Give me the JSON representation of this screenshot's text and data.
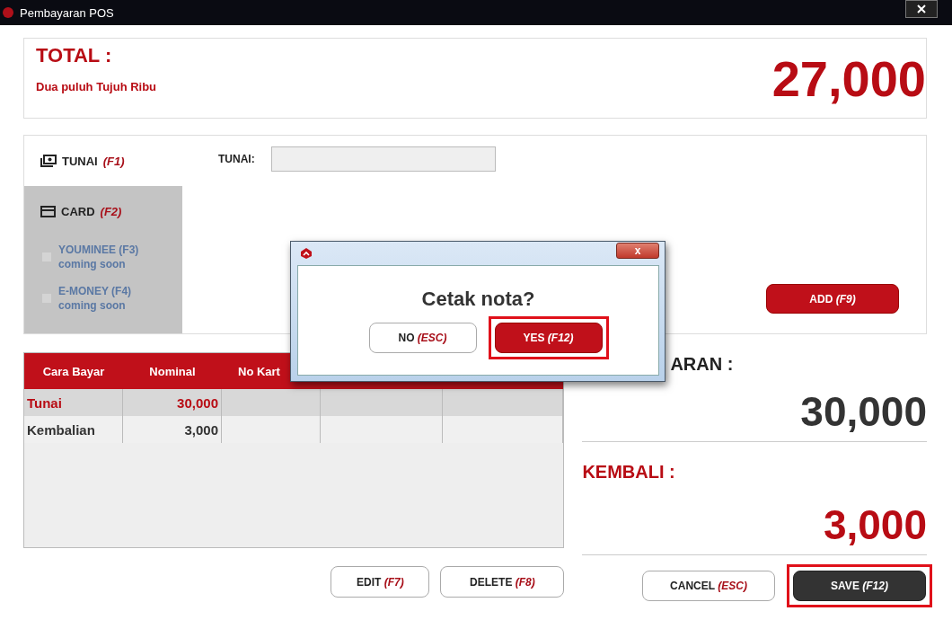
{
  "window": {
    "title": "Pembayaran POS"
  },
  "total": {
    "label": "TOTAL :",
    "words": "Dua puluh Tujuh Ribu",
    "amount": "27,000"
  },
  "methods": [
    {
      "kind": "cash",
      "label": "TUNAI",
      "key": "(F1)",
      "selected": true,
      "disabled": false
    },
    {
      "kind": "card",
      "label": "CARD",
      "key": "(F2)",
      "selected": false,
      "disabled": false
    },
    {
      "kind": "ewallet",
      "label": "YOUMINEE (F3)",
      "note": "coming soon",
      "selected": false,
      "disabled": true
    },
    {
      "kind": "ewallet",
      "label": "E-MONEY (F4)",
      "note": "coming soon",
      "selected": false,
      "disabled": true
    }
  ],
  "cash_field": {
    "label": "TUNAI:"
  },
  "add_button": {
    "label": "ADD",
    "key": "(F9)"
  },
  "table": {
    "columns": [
      "Cara Bayar",
      "Nominal",
      "No Kart"
    ],
    "rows": [
      {
        "kind": "payment",
        "cells": [
          "Tunai",
          "30,000",
          "",
          "",
          ""
        ]
      },
      {
        "kind": "change",
        "cells": [
          "Kembalian",
          "3,000",
          "",
          "",
          ""
        ]
      }
    ]
  },
  "table_buttons": [
    {
      "label": "EDIT",
      "key": "(F7)"
    },
    {
      "label": "DELETE",
      "key": "(F8)"
    }
  ],
  "paid": {
    "label": "ARAN :",
    "amount": "30,000"
  },
  "change": {
    "label": "KEMBALI :",
    "amount": "3,000"
  },
  "footer_buttons": [
    {
      "kind": "plain",
      "label": "CANCEL",
      "key": "(ESC)",
      "highlighted": false
    },
    {
      "kind": "dark",
      "label": "SAVE",
      "key": "(F12)",
      "highlighted": true
    }
  ],
  "dialog": {
    "message": "Cetak nota?",
    "close": "x",
    "buttons": [
      {
        "kind": "plain",
        "label": "NO",
        "key": "(ESC)",
        "highlighted": false
      },
      {
        "kind": "primary",
        "label": "YES",
        "key": "(F12)",
        "highlighted": true
      }
    ]
  }
}
